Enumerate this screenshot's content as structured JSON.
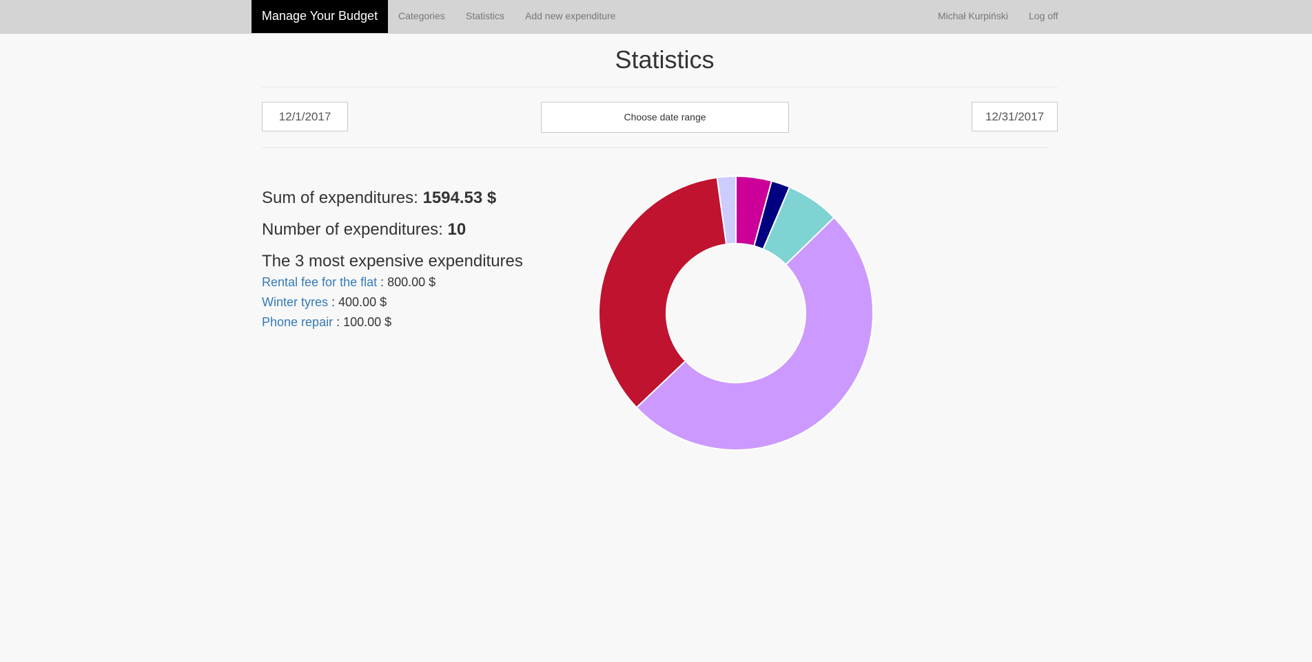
{
  "nav": {
    "brand": "Manage Your Budget",
    "links": [
      "Categories",
      "Statistics",
      "Add new expenditure"
    ],
    "user": "Michał Kurpiński",
    "logoff": "Log off"
  },
  "page": {
    "title": "Statistics",
    "start_date": "12/1/2017",
    "end_date": "12/31/2017",
    "range_button": "Choose date range"
  },
  "summary": {
    "sum_label": "Sum of expenditures: ",
    "sum_value": "1594.53 $",
    "count_label": "Number of expenditures: ",
    "count_value": "10",
    "top_heading": "The 3 most expensive expenditures",
    "top": [
      {
        "name": "Rental fee for the flat",
        "amount": " : 800.00 $"
      },
      {
        "name": "Winter tyres",
        "amount": " : 400.00 $"
      },
      {
        "name": "Phone repair",
        "amount": " : 100.00 $"
      }
    ]
  },
  "chart_data": {
    "type": "pie",
    "donut": true,
    "slices": [
      {
        "percent": 4.2,
        "color": "#cc0099"
      },
      {
        "percent": 2.2,
        "color": "#000080"
      },
      {
        "percent": 6.3,
        "color": "#7fd3d3"
      },
      {
        "percent": 50.2,
        "color": "#cc99ff"
      },
      {
        "percent": 34.9,
        "color": "#bf1330"
      },
      {
        "percent": 2.2,
        "color": "#ccccff"
      }
    ]
  }
}
